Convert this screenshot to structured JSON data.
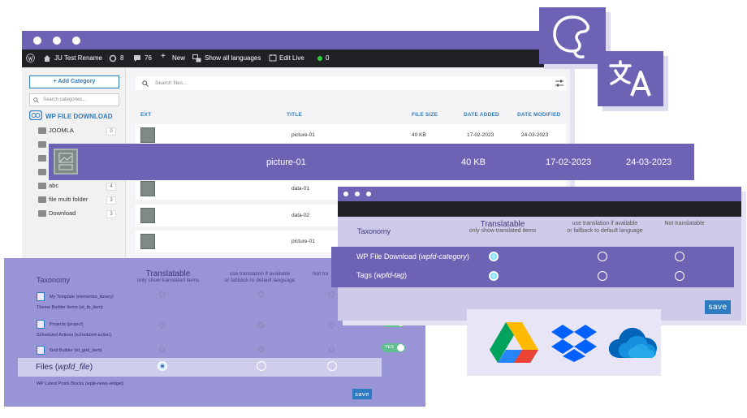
{
  "admin_bar": {
    "site_name": "JU Test Rename",
    "updates_count": "8",
    "comments_count": "76",
    "new_label": "New",
    "languages_label": "Show all languages",
    "edit_label": "Edit Live",
    "status_count": "0"
  },
  "sidebar": {
    "add_category": "+ Add Category",
    "search_placeholder": "Search categories...",
    "brand": "WP FILE DOWNLOAD",
    "folders": [
      {
        "label": "JOOMLA",
        "count": "0"
      },
      {
        "label": "abc",
        "count": "4"
      },
      {
        "label": "file multi folder",
        "count": "3"
      },
      {
        "label": "Download",
        "count": "3"
      }
    ]
  },
  "files": {
    "search_placeholder": "Search files...",
    "columns": [
      "EXT",
      "TITLE",
      "FILE SIZE",
      "DATE ADDED",
      "DATE MODIFIED"
    ],
    "rows": [
      {
        "title": "picture-01",
        "size": "40 KB",
        "added": "17-02-2023",
        "modified": "24-03-2023"
      },
      {
        "title": "data-01",
        "size": "",
        "added": "",
        "modified": ""
      },
      {
        "title": "data-02",
        "size": "",
        "added": "",
        "modified": ""
      },
      {
        "title": "picture-01",
        "size": "",
        "added": "",
        "modified": ""
      }
    ]
  },
  "highlight": {
    "title": "picture-01",
    "size": "40 KB",
    "added": "17-02-2023",
    "modified": "24-03-2023"
  },
  "right_panel": {
    "taxonomy_label": "Taxonomy",
    "translatable": "Translatable",
    "translatable_sub": "only show translated items",
    "fallback_line1": "use translation if available",
    "fallback_line2": "or fallback to default language",
    "not_translatable": "Not translatable",
    "rows": [
      {
        "label_main": "WP File Download (",
        "label_code": "wpfd-category",
        "label_end": ")"
      },
      {
        "label_main": "Tags (",
        "label_code": "wpfd-tag",
        "label_end": ")"
      }
    ],
    "save": "save"
  },
  "bottom_panel": {
    "taxonomy_label": "Taxonomy",
    "translatable": "Translatable",
    "translatable_sub": "only show translated items",
    "fallback_line1": "use translation if available",
    "fallback_line2": "or fallback to default language",
    "not_translatable": "Not tra",
    "items": [
      {
        "label": "My Template (elementor_library)"
      },
      {
        "label": "Theme Builder Items (et_tb_item)"
      },
      {
        "label": "Projects (project)"
      },
      {
        "label": "Scheduled Actions (scheduled-action)"
      },
      {
        "label": "Grid Builder (et_grid_item)"
      },
      {
        "label": "WP Latest Posts Blocks (wplp-news-widget)"
      }
    ],
    "toggle_label": "YES",
    "files_main": "Files (",
    "files_code": "wpfd_file",
    "files_end": ")",
    "save": "save"
  },
  "colors": {
    "brand_purple": "#6c63b5",
    "light_purple": "#9894d5",
    "accent_blue": "#2d7cc1",
    "admin_black": "#1f2124"
  },
  "cloud_icons": [
    "google-drive-icon",
    "dropbox-icon",
    "onedrive-icon"
  ]
}
